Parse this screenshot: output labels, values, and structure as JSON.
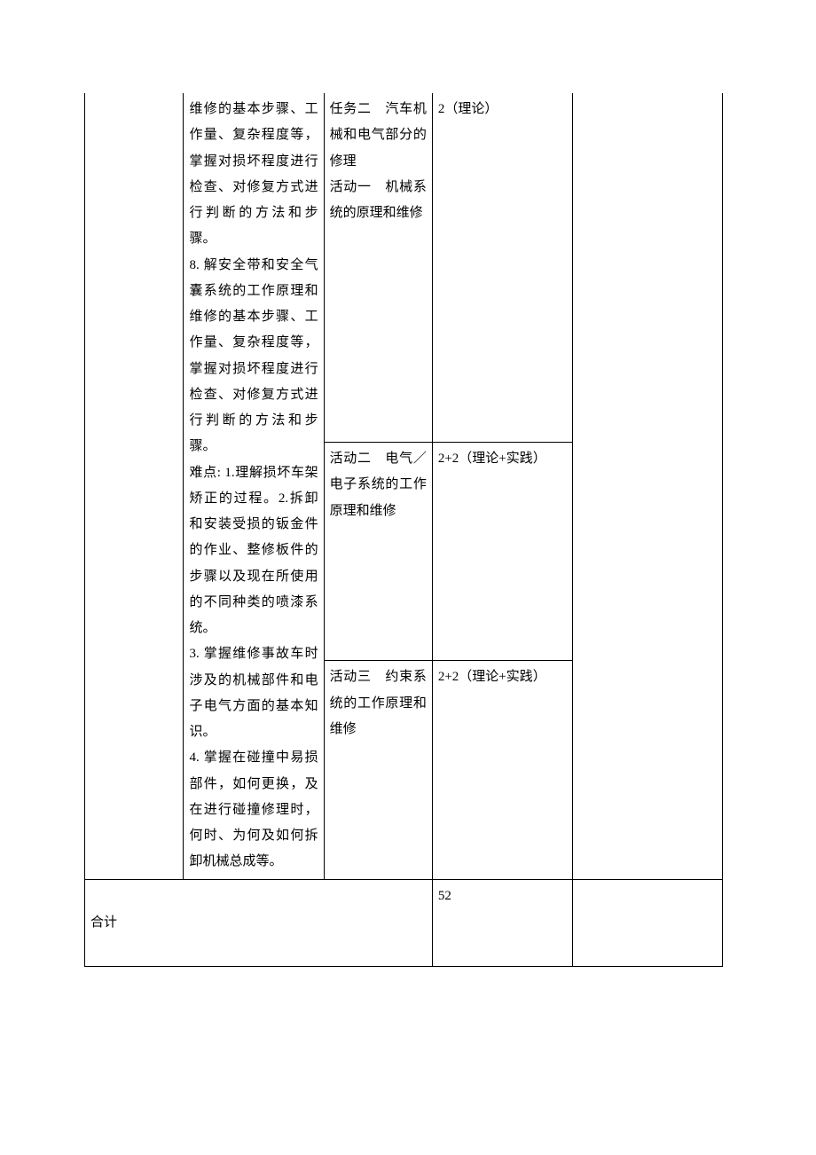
{
  "rows": [
    {
      "col2_first": "维修的基本步骤、工作量、复杂程度等，掌握对损坏程度进行检查、对修复方式进行判断的方法和步骤。\n8. 解安全带和安全气囊系统的工作原理和维修的基本步骤、工作量、复杂程度等，掌握对损坏程度进行检查、对修复方式进行判断的方法和步骤。\n难点: 1.理解损坏车架矫正的过程。2.拆卸和安装受损的钣金件的作业、整修板件的步骤以及现在所使用的不同种类的喷漆系统。\n3. 掌握维修事故车时涉及的机械部件和电子电气方面的基本知识。\n4. 掌握在碰撞中易损部件，如何更换，及在进行碰撞修理时，何时、为何及如何拆卸机械总成等。",
      "col3_r1": "任务二　汽车机械和电气部分的修理\n活动一　机械系统的原理和维修",
      "col4_r1": "2（理论）",
      "col3_r2": "活动二　电气／电子系统的工作原理和维修",
      "col4_r2": "2+2（理论+实践）",
      "col3_r3": "活动三　约束系统的工作原理和维修",
      "col4_r3": "2+2（理论+实践）"
    }
  ],
  "total": {
    "label": "合计",
    "value": "52"
  }
}
